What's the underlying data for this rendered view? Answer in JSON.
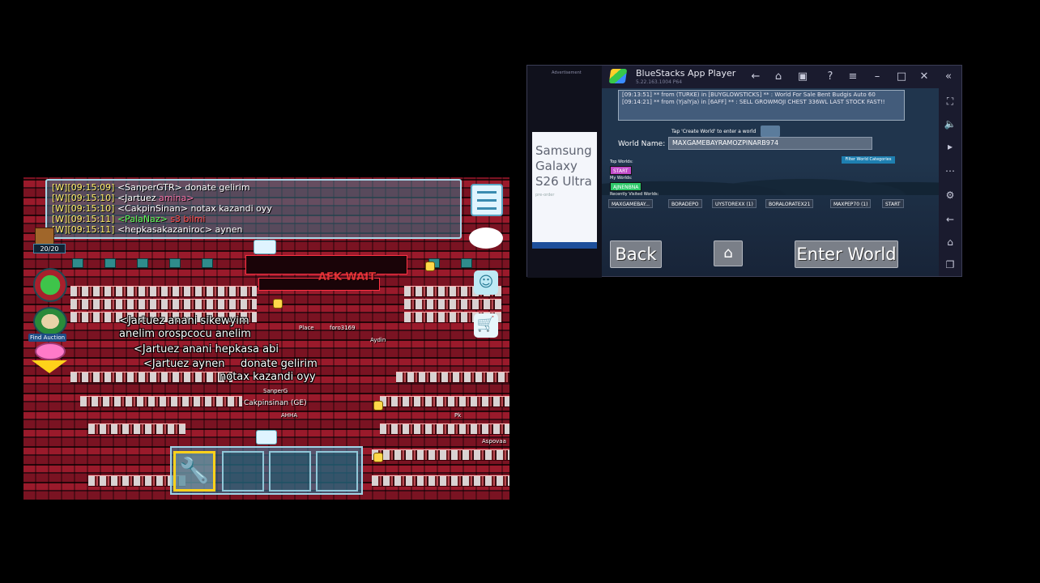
{
  "game": {
    "chat": [
      {
        "tag": "[W]",
        "time": "[09:15:09]",
        "name": "<SanperGTR>",
        "msg": "donate gelirim",
        "name_style": "w",
        "msg_style": "w"
      },
      {
        "tag": "[W]",
        "time": "[09:15:10]",
        "name": "<Jartuez",
        "msg": "amina>",
        "name_style": "w",
        "msg_style": "pink"
      },
      {
        "tag": "[W]",
        "time": "[09:15:10]",
        "name": "<CakpinSinan>",
        "msg": "notax kazandi oyy",
        "name_style": "w",
        "msg_style": "w"
      },
      {
        "tag": "[W]",
        "time": "[09:15:11]",
        "name": "<PalaNaz>",
        "msg": "s3 bilmi",
        "name_style": "g",
        "msg_style": "red"
      },
      {
        "tag": "[W]",
        "time": "[09:15:11]",
        "name": "<hepkasakazaniroc>",
        "msg": "aynen",
        "name_style": "w",
        "msg_style": "w"
      }
    ],
    "gem_count": "20/20",
    "find_auction_label": "Find Auction",
    "afk_sign": "AFK WAIT",
    "overhead_text": [
      "<Jartuez anani sikewyim",
      "anelim orospcocu anelim",
      "<Jartuez anani hepkasa abi",
      "<Jartuez aynen",
      "donate gelirim",
      "notax kazandi oyy"
    ],
    "player_tags": {
      "cakpin": "Cakpinsinan (GE)",
      "place": "Place",
      "player": "Player",
      "foro": "foro3169",
      "aydin": "Aydin",
      "sanper": "SanperG",
      "aspovaa": "Aspovaa",
      "ahha": "AHHA",
      "pk": "Pk"
    },
    "hotbar_selected_icon": "wrench-icon"
  },
  "bluestacks": {
    "ad_top": "Advertisement",
    "ad_title": "Samsung Galaxy S26 Ultra",
    "ad_sub": "pre-order",
    "title": "BlueStacks App Player",
    "version": "5.22.163.1004  P64",
    "screen": {
      "chat_lines": [
        "[09:13:51] ** from (TURKE) in [BUYGLOWSTICKS] ** : World For Sale Bent Budgis Auto 60",
        "[09:14:21] ** from (YjalYja) in [6AFF] ** : SELL GROWMOJI CHEST 336WL LAST STOCK FAST!!"
      ],
      "hint": "Tap 'Create World' to enter a world",
      "world_name_label": "World Name:",
      "world_name_value": "MAXGAMEBAYRAMOZPINARB974",
      "filter_label": "Filter World Categories",
      "top_worlds_label": "Top Worlds:",
      "top_worlds": [
        "START"
      ],
      "my_worlds_label": "My Worlds:",
      "my_worlds": [
        "AJNENBNA"
      ],
      "recent_label": "Recently Visited Worlds:",
      "recent": [
        "MAXGAMEBAY...",
        "BORADEPO",
        "UYSTOREXX (1)",
        "BORALORATEX21",
        "MAXPEP70 (1)",
        "START"
      ],
      "back_label": "Back",
      "enter_label": "Enter World"
    }
  },
  "colors": {
    "chat_tag": "#ffef6a",
    "chat_green": "#5aff5a",
    "bs_bg": "#1a1b2e",
    "world_pill_purple": "#c04ac8",
    "world_pill_green": "#2ec86a"
  }
}
